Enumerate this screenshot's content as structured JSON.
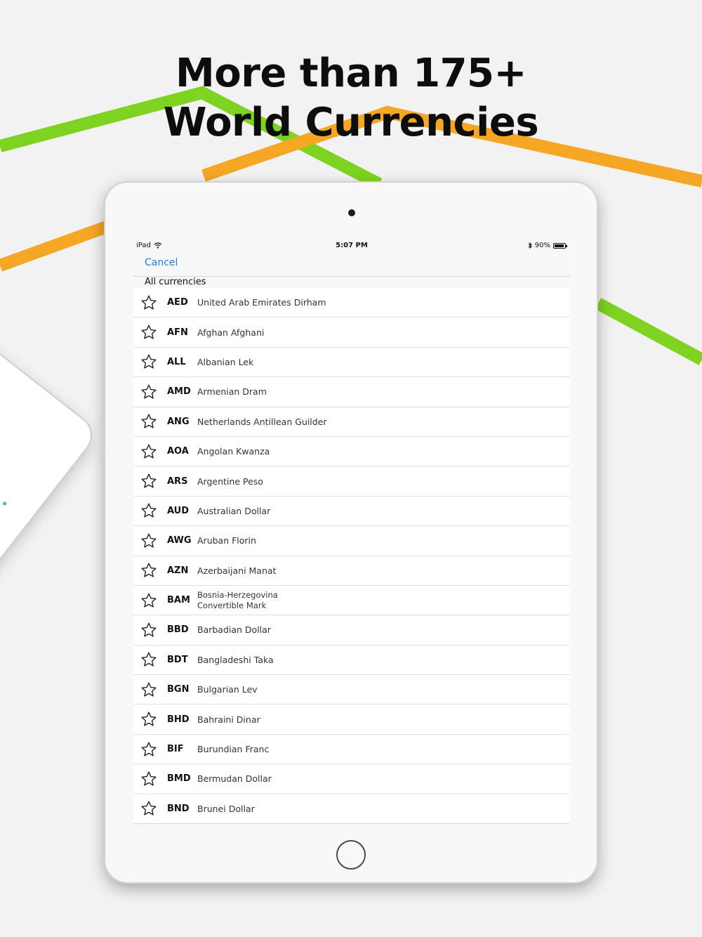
{
  "headline": {
    "line1": "More than 175+",
    "line2": "World Currencies"
  },
  "colors": {
    "green_line": "#7ed321",
    "orange_line": "#f5a623",
    "link_blue": "#2a7ad6"
  },
  "status_bar": {
    "device": "iPad",
    "time": "5:07 PM",
    "battery": "90%",
    "icons": [
      "wifi-icon",
      "bluetooth-icon",
      "battery-icon"
    ]
  },
  "nav": {
    "cancel_label": "Cancel"
  },
  "section": {
    "title": "All currencies"
  },
  "currencies": [
    {
      "code": "AED",
      "name": "United Arab Emirates Dirham"
    },
    {
      "code": "AFN",
      "name": "Afghan Afghani"
    },
    {
      "code": "ALL",
      "name": "Albanian Lek"
    },
    {
      "code": "AMD",
      "name": "Armenian Dram"
    },
    {
      "code": "ANG",
      "name": "Netherlands Antillean Guilder"
    },
    {
      "code": "AOA",
      "name": "Angolan Kwanza"
    },
    {
      "code": "ARS",
      "name": "Argentine Peso"
    },
    {
      "code": "AUD",
      "name": "Australian Dollar"
    },
    {
      "code": "AWG",
      "name": "Aruban Florin"
    },
    {
      "code": "AZN",
      "name": "Azerbaijani Manat"
    },
    {
      "code": "BAM",
      "name": "Bosnia-Herzegovina",
      "name_line2": "Convertible Mark"
    },
    {
      "code": "BBD",
      "name": "Barbadian Dollar"
    },
    {
      "code": "BDT",
      "name": "Bangladeshi Taka"
    },
    {
      "code": "BGN",
      "name": "Bulgarian Lev"
    },
    {
      "code": "BHD",
      "name": "Bahraini Dinar"
    },
    {
      "code": "BIF",
      "name": "Burundian Franc"
    },
    {
      "code": "BMD",
      "name": "Bermudan Dollar"
    },
    {
      "code": "BND",
      "name": "Brunei Dollar"
    }
  ]
}
